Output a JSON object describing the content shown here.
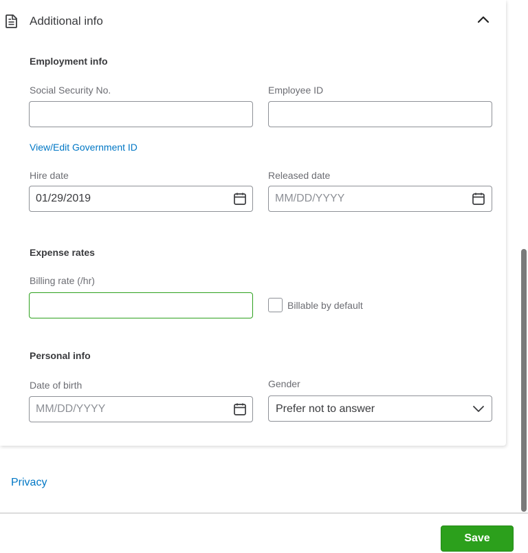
{
  "card": {
    "title": "Additional info",
    "header_icon": "document-icon",
    "collapse_icon": "chevron-up-icon"
  },
  "employment": {
    "section_title": "Employment info",
    "ssn": {
      "label": "Social Security No.",
      "value": "",
      "placeholder": ""
    },
    "employee_id": {
      "label": "Employee ID",
      "value": "",
      "placeholder": ""
    },
    "gov_id_link": "View/Edit Government ID",
    "hire_date": {
      "label": "Hire date",
      "value": "01/29/2019",
      "placeholder": "MM/DD/YYYY",
      "icon": "calendar-icon"
    },
    "released_date": {
      "label": "Released date",
      "value": "",
      "placeholder": "MM/DD/YYYY",
      "icon": "calendar-icon"
    }
  },
  "expense": {
    "section_title": "Expense rates",
    "billing_rate": {
      "label": "Billing rate (/hr)",
      "value": "",
      "placeholder": "",
      "focused": true
    },
    "billable_default": {
      "label": "Billable by default",
      "checked": false
    }
  },
  "personal": {
    "section_title": "Personal info",
    "dob": {
      "label": "Date of birth",
      "value": "",
      "placeholder": "MM/DD/YYYY",
      "icon": "calendar-icon"
    },
    "gender": {
      "label": "Gender",
      "selected": "Prefer not to answer",
      "icon": "chevron-down-icon"
    }
  },
  "footer": {
    "privacy_link": "Privacy",
    "save_label": "Save"
  },
  "colors": {
    "accent_green": "#2ca01c",
    "link_blue": "#0077c5",
    "text_primary": "#393a3d",
    "text_secondary": "#6b6c72"
  }
}
